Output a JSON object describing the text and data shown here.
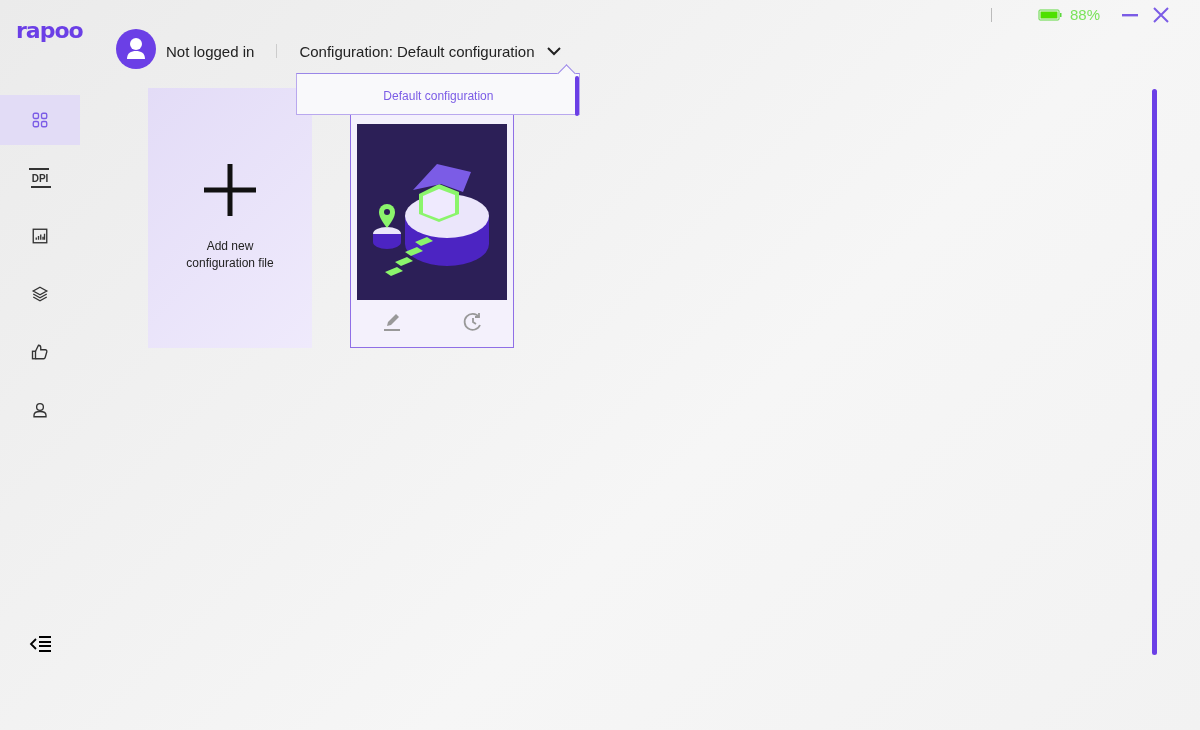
{
  "logo": {
    "text": "rapoo"
  },
  "sidebar": {
    "items": [
      {
        "kind": "grid",
        "selected": true
      },
      {
        "kind": "dpi",
        "text": "DPI",
        "selected": false
      },
      {
        "kind": "chart",
        "selected": false
      },
      {
        "kind": "layers",
        "selected": false
      },
      {
        "kind": "thumb",
        "selected": false
      },
      {
        "kind": "user",
        "selected": false
      }
    ]
  },
  "status": {
    "battery": "88%"
  },
  "header": {
    "user": "Not logged in",
    "configuration": "Configuration: Default configuration",
    "dropdown": {
      "expanded": true,
      "options": [
        {
          "label": "Default configuration",
          "selected": true
        }
      ]
    }
  },
  "cards": [
    {
      "kind": "add",
      "label": "Add new configuration file"
    },
    {
      "kind": "config",
      "selected": true
    }
  ]
}
